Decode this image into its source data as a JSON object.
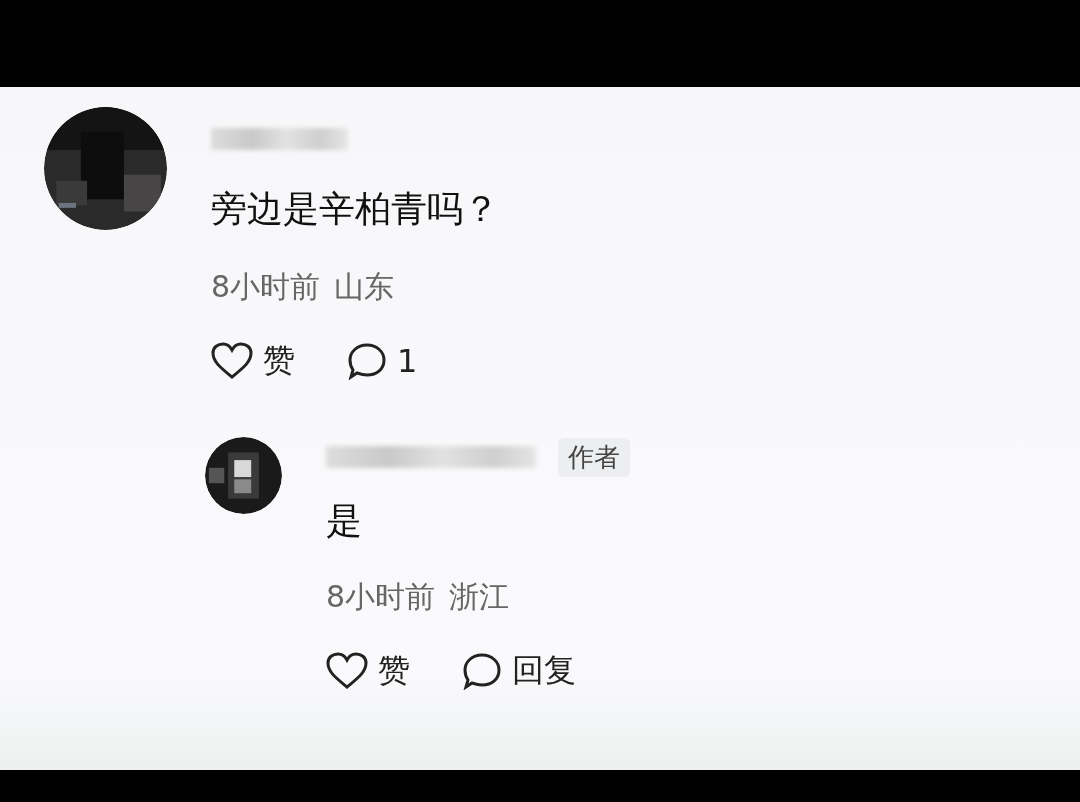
{
  "comment": {
    "text": "旁边是辛柏青吗？",
    "time": "8小时前",
    "location": "山东",
    "like_label": "赞",
    "reply_count": "1",
    "replies": [
      {
        "badge": "作者",
        "text": "是",
        "time": "8小时前",
        "location": "浙江",
        "like_label": "赞",
        "reply_label": "回复"
      }
    ]
  }
}
